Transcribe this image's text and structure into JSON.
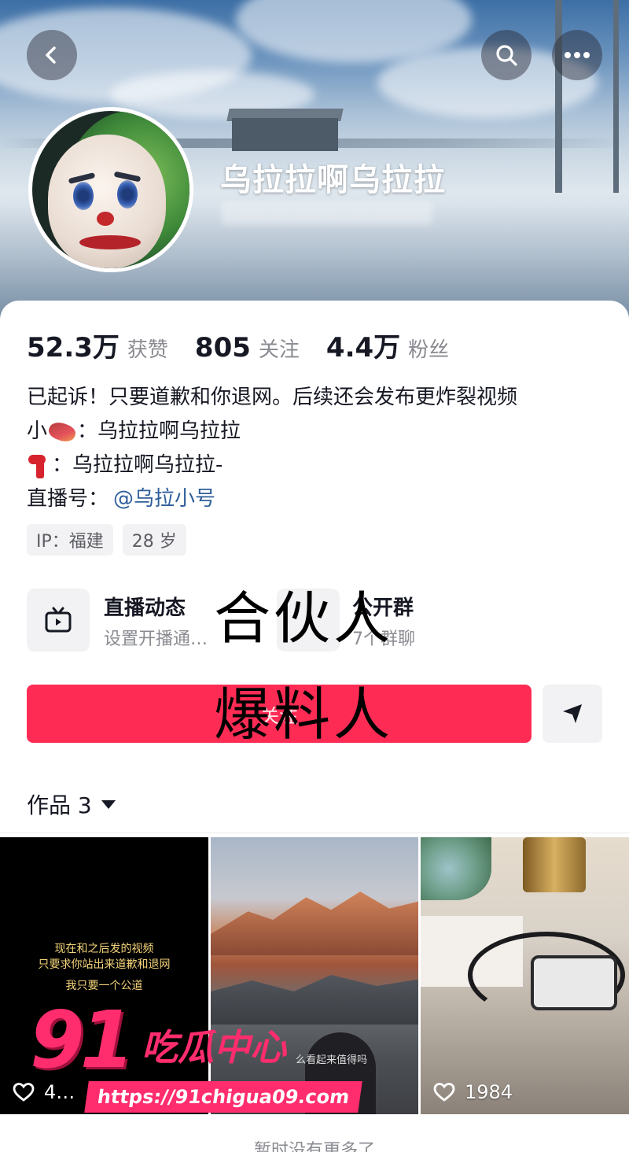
{
  "profile": {
    "name": "乌拉拉啊乌拉拉"
  },
  "stats": [
    {
      "value": "52.3万",
      "label": "获赞"
    },
    {
      "value": "805",
      "label": "关注"
    },
    {
      "value": "4.4万",
      "label": "粉丝"
    }
  ],
  "bio": {
    "line1": "已起诉！只要道歉和你退网。后续还会发布更炸裂视频",
    "line2_prefix": "小",
    "line2_text": "：乌拉拉啊乌拉拉",
    "line3_text": "：乌拉拉啊乌拉拉-",
    "line4_label": "直播号：",
    "line4_link": "@乌拉小号"
  },
  "tags": [
    "IP：福建",
    "28 岁"
  ],
  "entries": {
    "live_title": "直播动态",
    "live_sub": "设置开播通…",
    "group_title": "公开群",
    "group_sub": "7个群聊"
  },
  "overlay": {
    "line1": "合伙人",
    "line2": "爆料人"
  },
  "actions": {
    "follow_label": "关注"
  },
  "works": {
    "tab_label": "作品 3"
  },
  "videos": [
    {
      "caption_1": "现在和之后发的视频",
      "caption_2": "只要求你站出来道歉和退网",
      "caption_3": "我只要一个公道",
      "likes": "4…"
    },
    {
      "subtitle": "么看起来值得吗",
      "likes": ""
    },
    {
      "likes": "1984"
    }
  ],
  "watermark": {
    "number": "91",
    "brand": "吃瓜中心",
    "url": "https://91chigua09.com"
  },
  "footer": {
    "end_text": "暂时没有更多了"
  },
  "icons": [
    "back-icon",
    "search-icon",
    "more-icon",
    "tv-icon",
    "share-icon",
    "heart-icon"
  ],
  "colors": {
    "accent": "#fe2c55",
    "link": "#2f5f9a",
    "watermark": "#ff2d6d"
  }
}
